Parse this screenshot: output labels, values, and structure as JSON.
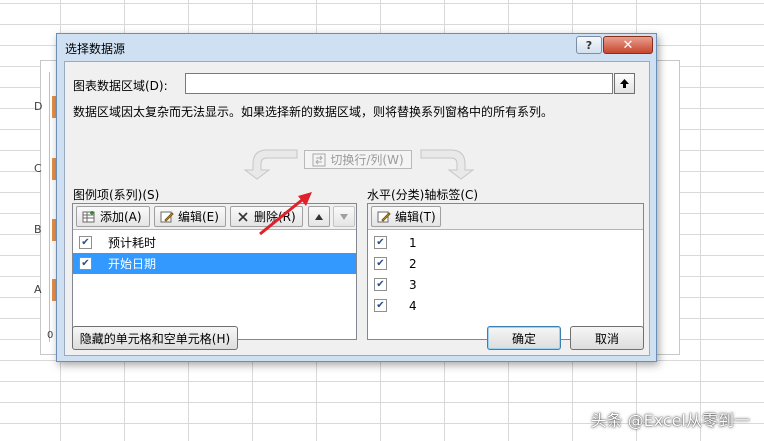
{
  "background": {
    "axis_labels": [
      "D",
      "C",
      "B",
      "A"
    ],
    "zero_label": "0",
    "watermark": "头条 @Excel从零到一"
  },
  "dialog": {
    "title": "选择数据源",
    "help_label": "?",
    "close_label": "✕",
    "range_label": "图表数据区域(D):",
    "range_value": "",
    "message": "数据区域因太复杂而无法显示。如果选择新的数据区域，则将替换系列窗格中的所有系列。",
    "switch_label": "切换行/列(W)",
    "series_panel": {
      "title": "图例项(系列)(S)",
      "add_label": "添加(A)",
      "edit_label": "编辑(E)",
      "delete_label": "删除(R)",
      "items": [
        {
          "label": "预计耗时",
          "checked": true,
          "selected": false
        },
        {
          "label": "开始日期",
          "checked": true,
          "selected": true
        }
      ]
    },
    "category_panel": {
      "title": "水平(分类)轴标签(C)",
      "edit_label": "编辑(T)",
      "items": [
        {
          "label": "1",
          "checked": true
        },
        {
          "label": "2",
          "checked": true
        },
        {
          "label": "3",
          "checked": true
        },
        {
          "label": "4",
          "checked": true
        }
      ]
    },
    "hidden_cells_label": "隐藏的单元格和空单元格(H)",
    "ok_label": "确定",
    "cancel_label": "取消"
  },
  "colors": {
    "selection": "#3399ff",
    "bar_accent": "#e58f4a",
    "annotation_arrow": "#e0202a"
  }
}
